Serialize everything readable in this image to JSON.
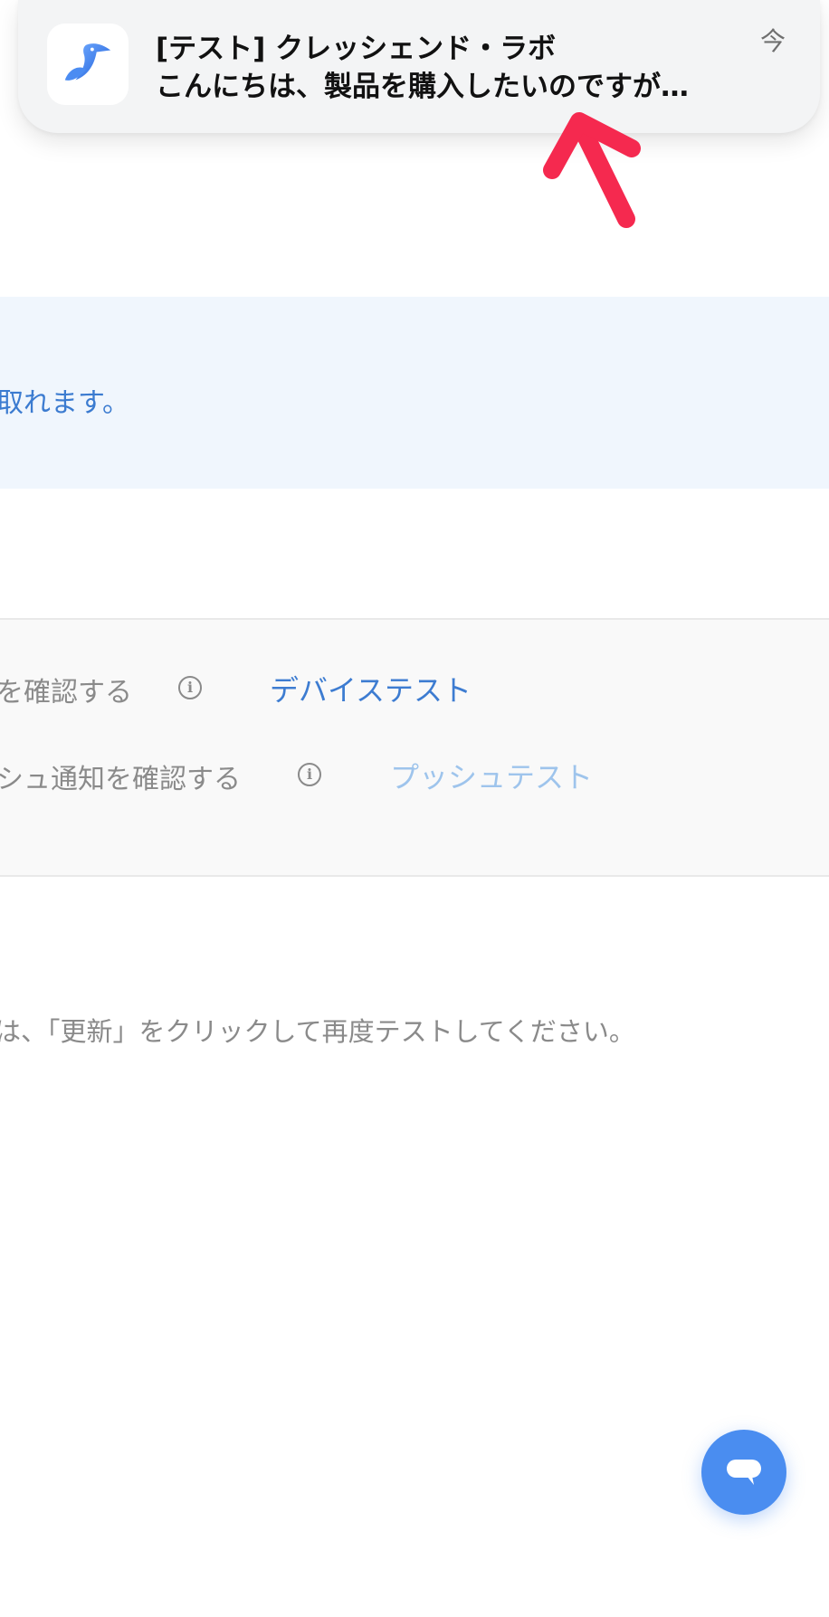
{
  "notification": {
    "title": "[テスト] クレッシェンド・ラボ",
    "body": "こんにちは、製品を購入したいのですが…",
    "time": "今",
    "app_icon": "pelican-logo-icon"
  },
  "annotation": {
    "arrow_color": "#f5294f"
  },
  "info_banner": {
    "text": "取れます。"
  },
  "test_panel": {
    "row1": {
      "label": "を確認する",
      "link": "デバイステスト",
      "icon": "info-icon",
      "state": "enabled"
    },
    "row2": {
      "label": "シュ通知を確認する",
      "link": "プッシュテスト",
      "icon": "info-icon",
      "state": "disabled"
    }
  },
  "hint": {
    "text": "は、「更新」をクリックして再度テストしてください。"
  },
  "chat_button": {
    "icon": "chat-bubble-icon",
    "color": "#4a8df0"
  },
  "colors": {
    "link": "#3d7cd1",
    "link_disabled": "#9ec4ec",
    "banner_bg": "#f0f6fd",
    "muted_text": "#8a8a8a"
  }
}
